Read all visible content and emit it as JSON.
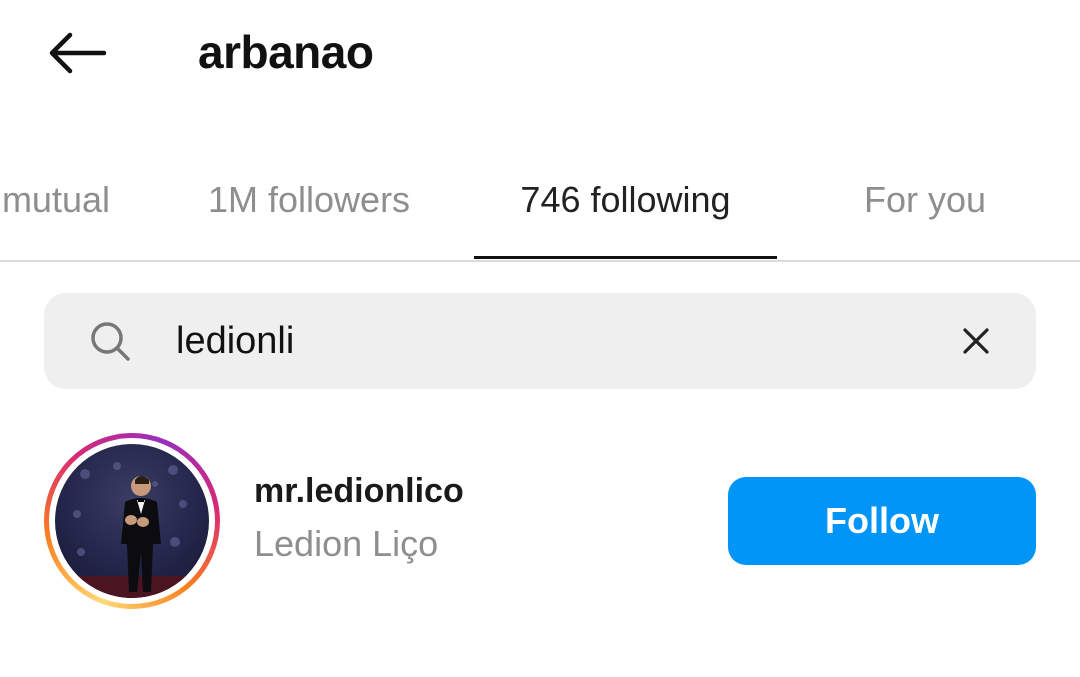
{
  "header": {
    "title": "arbanao",
    "back_icon": "arrow-left-icon"
  },
  "tabs": [
    {
      "label": "mutual",
      "active": false
    },
    {
      "label": "1M followers",
      "active": false
    },
    {
      "label": "746 following",
      "active": true
    },
    {
      "label": "For you",
      "active": false
    }
  ],
  "search": {
    "value": "ledionli",
    "icon": "search-icon",
    "clear_icon": "close-icon"
  },
  "results": [
    {
      "username": "mr.ledionlico",
      "full_name": "Ledion Liço",
      "button_label": "Follow",
      "has_story_ring": true
    }
  ],
  "colors": {
    "follow_button": "#0095f6",
    "search_bg": "#efefef",
    "muted_text": "#8e8e8e",
    "active_text": "#222222"
  }
}
